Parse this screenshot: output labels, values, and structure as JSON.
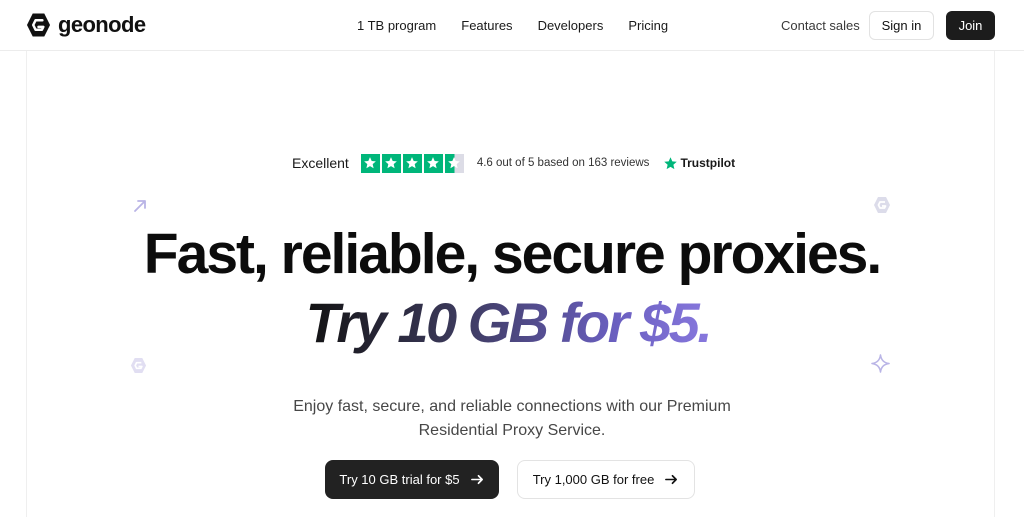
{
  "header": {
    "brand": "geonode",
    "nav": [
      "1 TB program",
      "Features",
      "Developers",
      "Pricing"
    ],
    "contact_sales": "Contact sales",
    "sign_in": "Sign in",
    "join": "Join"
  },
  "rating": {
    "label": "Excellent",
    "score": 4.6,
    "summary": "4.6 out of 5 based on 163 reviews",
    "provider": "Trustpilot"
  },
  "hero": {
    "headline": "Fast, reliable, secure proxies.",
    "subheadline": "Try 10 GB for $5.",
    "description_line1": "Enjoy fast, secure, and reliable connections with our Premium",
    "description_line2": "Residential Proxy Service.",
    "primary_cta": "Try 10 GB trial for $5",
    "secondary_cta": "Try 1,000 GB for free"
  },
  "colors": {
    "trustpilot_green": "#00b67a",
    "accent_purple": "#8a7ae0",
    "dark_button": "#222222"
  }
}
